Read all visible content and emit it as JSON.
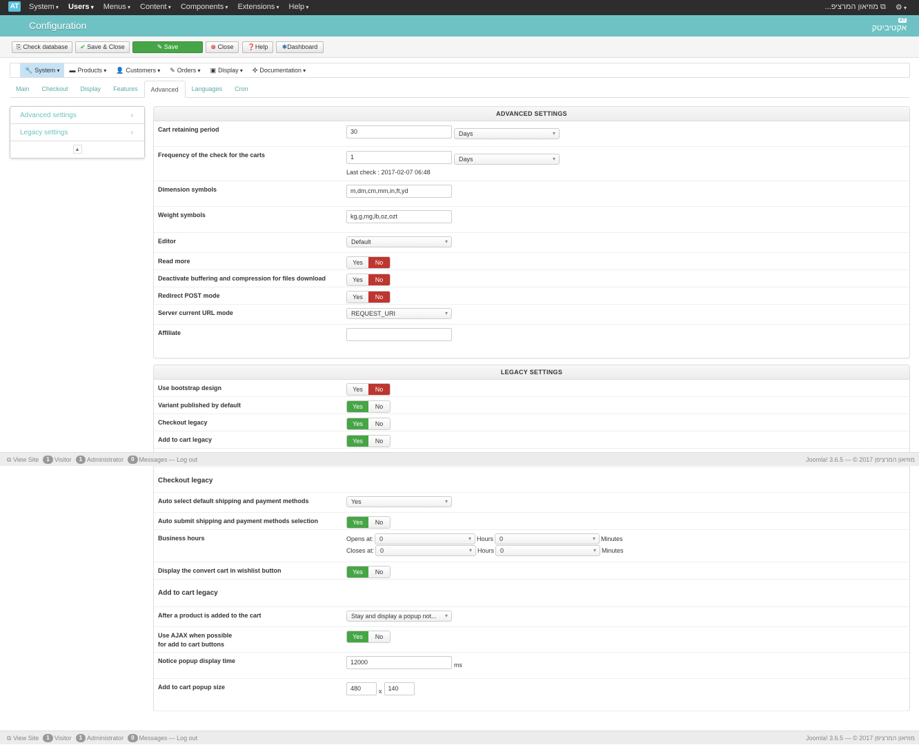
{
  "topnav": {
    "logo": "AT",
    "menu": [
      "System",
      "Users",
      "Menus",
      "Content",
      "Components",
      "Extensions",
      "Help"
    ],
    "active": "Users",
    "site_link": "...מוזיאון המרציפ",
    "gear_icon": "gear-icon"
  },
  "header": {
    "title": "Configuration",
    "brand": "אקטיביטק",
    "brand_badge": "AT",
    "color": "#6ec2c4"
  },
  "toolbar": {
    "check_db": "Check database",
    "save_close": "Save & Close",
    "save": "Save",
    "close": "Close",
    "help": "Help",
    "dashboard": "Dashboard"
  },
  "submenu": [
    {
      "label": "System",
      "icon": "🔧"
    },
    {
      "label": "Products",
      "icon": "▬"
    },
    {
      "label": "Customers",
      "icon": "👤"
    },
    {
      "label": "Orders",
      "icon": "✎"
    },
    {
      "label": "Display",
      "icon": "▣"
    },
    {
      "label": "Documentation",
      "icon": "✣"
    }
  ],
  "tabs": [
    "Main",
    "Checkout",
    "Display",
    "Features",
    "Advanced",
    "Languages",
    "Cron"
  ],
  "active_tab": "Advanced",
  "sidenav": {
    "items": [
      "Advanced settings",
      "Legacy settings"
    ],
    "up_icon": "▲"
  },
  "advanced": {
    "title": "ADVANCED SETTINGS",
    "rows": [
      {
        "label": "Cart retaining period",
        "type": "input-select",
        "value": "30",
        "select": "Days"
      },
      {
        "label": "Frequency of the check for the carts",
        "type": "input-select",
        "value": "1",
        "select": "Days",
        "note": "Last check : 2017-02-07 06:48"
      },
      {
        "label": "Dimension symbols",
        "type": "input",
        "value": "m,dm,cm,mm,in,ft,yd"
      },
      {
        "label": "Weight symbols",
        "type": "input",
        "value": "kg,g,mg,lb,oz,ozt"
      },
      {
        "label": "Editor",
        "type": "select",
        "value": "Default"
      },
      {
        "label": "Read more",
        "type": "toggle",
        "yes": "Yes",
        "no": "No",
        "value": "No"
      },
      {
        "label": "Deactivate buffering and compression for files download",
        "type": "toggle",
        "yes": "Yes",
        "no": "No",
        "value": "No"
      },
      {
        "label": "Redirect POST mode",
        "type": "toggle",
        "yes": "Yes",
        "no": "No",
        "value": "No"
      },
      {
        "label": "Server current URL mode",
        "type": "select",
        "value": "REQUEST_URI"
      },
      {
        "label": "Affiliate",
        "type": "input",
        "value": ""
      }
    ]
  },
  "legacy": {
    "title": "LEGACY SETTINGS",
    "rows": [
      {
        "label": "Use bootstrap design",
        "type": "toggle",
        "yes": "Yes",
        "no": "No",
        "value": "No"
      },
      {
        "label": "Variant published by default",
        "type": "toggle",
        "yes": "Yes",
        "no": "No",
        "value": "Yes"
      },
      {
        "label": "Checkout legacy",
        "type": "toggle",
        "yes": "Yes",
        "no": "No",
        "value": "Yes"
      },
      {
        "label": "Add to cart legacy",
        "type": "toggle",
        "yes": "Yes",
        "no": "No",
        "value": "Yes"
      },
      {
        "label": "",
        "type": "toggle",
        "yes": "Yes",
        "no": "No",
        "value": "Yes"
      },
      {
        "label": "Checkout legacy",
        "type": "heading"
      },
      {
        "label": "Auto select default shipping and payment methods",
        "type": "select",
        "value": "Yes"
      },
      {
        "label": "Auto submit shipping and payment methods selection",
        "type": "toggle",
        "yes": "Yes",
        "no": "No",
        "value": "Yes"
      },
      {
        "label": "Business hours",
        "type": "hours",
        "opens": "Opens at:",
        "closes": "Closes at:",
        "hours": "Hours",
        "minutes": "Minutes",
        "open_h": "0",
        "open_m": "0",
        "close_h": "0",
        "close_m": "0"
      },
      {
        "label": "Display the convert cart in wishlist button",
        "type": "toggle",
        "yes": "Yes",
        "no": "No",
        "value": "Yes"
      },
      {
        "label": "Add to cart legacy",
        "type": "heading"
      },
      {
        "label": "After a product is added to the cart",
        "type": "select",
        "value": "Stay and display a popup not..."
      },
      {
        "label": "Use AJAX when possible\nfor add to cart buttons",
        "type": "toggle",
        "yes": "Yes",
        "no": "No",
        "value": "Yes"
      },
      {
        "label": "Notice popup display time",
        "type": "input-unit",
        "value": "12000",
        "unit": "ms"
      },
      {
        "label": "Add to cart popup size",
        "type": "size",
        "width": "480",
        "height": "140",
        "sep": "x"
      }
    ]
  },
  "footer": {
    "view_site": "View Site",
    "visitor_count": "1",
    "visitor": "Visitor",
    "admin_count": "1",
    "admin": "Administrator",
    "msg_count": "0",
    "messages": "Messages",
    "logout": "Log out",
    "version": "Joomla! 3.6.5 — © 2017 מוזיאון המרציפן"
  },
  "colors": {
    "yes_active": "#46a546",
    "no_active": "#bd362f",
    "topnav": "#2d2d2d"
  }
}
